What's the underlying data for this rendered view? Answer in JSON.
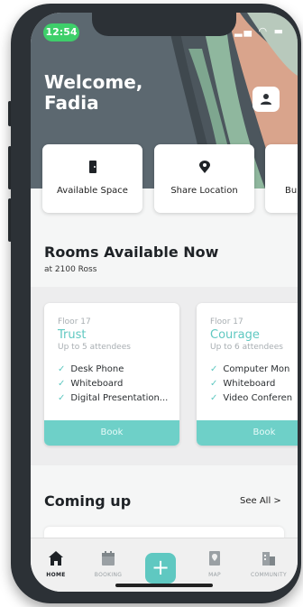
{
  "status_bar": {
    "time": "12:54"
  },
  "header": {
    "greeting": "Welcome,\nFadia"
  },
  "quick_actions": [
    {
      "label": "Available Space",
      "icon": "door-icon"
    },
    {
      "label": "Share Location",
      "icon": "location-pin-icon"
    },
    {
      "label": "Bui",
      "icon": "building-icon"
    }
  ],
  "rooms_section": {
    "title": "Rooms Available Now",
    "subtitle": "at 2100 Ross"
  },
  "rooms": [
    {
      "floor": "Floor 17",
      "name": "Trust",
      "capacity": "Up to 5 attendees",
      "amenities": [
        "Desk Phone",
        "Whiteboard",
        "Digital Presentation..."
      ],
      "book_label": "Book"
    },
    {
      "floor": "Floor 17",
      "name": "Courage",
      "capacity": "Up to 6 attendees",
      "amenities": [
        "Computer Mon",
        "Whiteboard",
        "Video Conferen"
      ],
      "book_label": "Book"
    }
  ],
  "coming_up": {
    "title": "Coming up",
    "see_all": "See All >"
  },
  "tabs": [
    {
      "label": "HOME",
      "icon": "home-icon",
      "active": true
    },
    {
      "label": "BOOKING",
      "icon": "calendar-icon",
      "active": false
    },
    {
      "label": "+",
      "icon": "plus-icon",
      "active": false
    },
    {
      "label": "MAP",
      "icon": "map-icon",
      "active": false
    },
    {
      "label": "COMMUNITY",
      "icon": "community-icon",
      "active": false
    }
  ],
  "colors": {
    "accent": "#5fc8c1",
    "hero": "#5c6870",
    "status_pill": "#3ecf6a"
  }
}
